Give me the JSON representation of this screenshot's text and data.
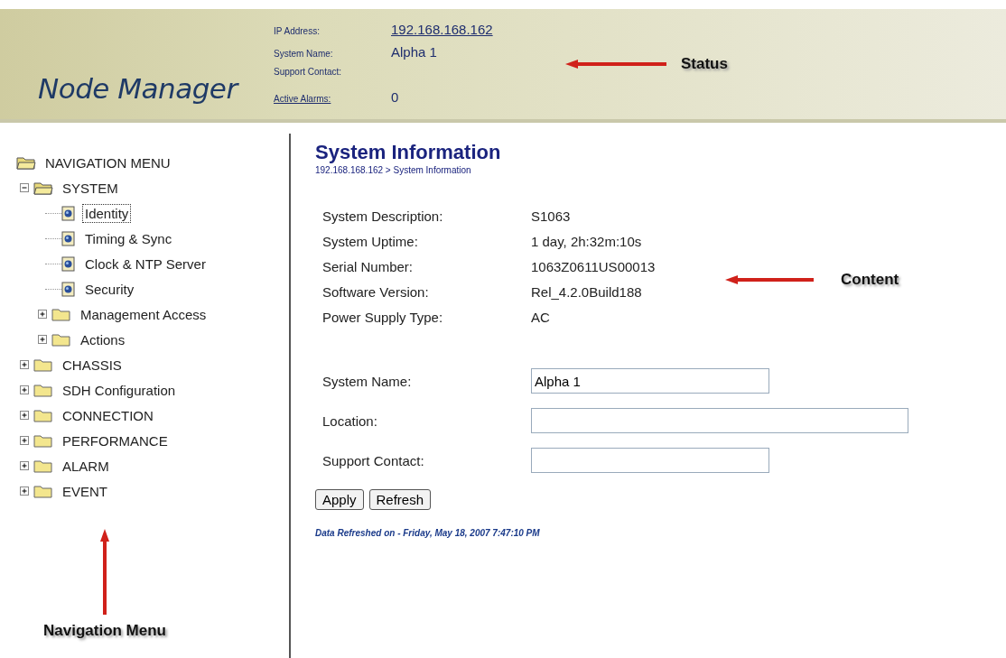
{
  "header": {
    "title": "Node Manager",
    "status": [
      {
        "label": "IP Address:",
        "value": "192.168.168.162",
        "label_link": false,
        "value_link": true
      },
      {
        "label": "System Name:",
        "value": "Alpha 1",
        "label_link": false,
        "value_link": false
      },
      {
        "label": "Support Contact:",
        "label_link": false
      },
      {
        "label": "Active Alarms:",
        "value": "0",
        "label_link": true,
        "value_link": false
      }
    ]
  },
  "navigation": {
    "title": "NAVIGATION MENU",
    "items": [
      {
        "label": "SYSTEM",
        "kind": "folder",
        "expanded": true,
        "children": [
          {
            "label": "Identity",
            "kind": "page",
            "selected": true
          },
          {
            "label": "Timing & Sync",
            "kind": "page",
            "selected": false
          },
          {
            "label": "Clock & NTP Server",
            "kind": "page",
            "selected": false
          },
          {
            "label": "Security",
            "kind": "page",
            "selected": false
          },
          {
            "label": "Management Access",
            "kind": "folder",
            "expanded": false
          },
          {
            "label": "Actions",
            "kind": "folder",
            "expanded": false
          }
        ]
      },
      {
        "label": "CHASSIS",
        "kind": "folder",
        "expanded": false
      },
      {
        "label": "SDH Configuration",
        "kind": "folder",
        "expanded": false
      },
      {
        "label": "CONNECTION",
        "kind": "folder",
        "expanded": false
      },
      {
        "label": "PERFORMANCE",
        "kind": "folder",
        "expanded": false
      },
      {
        "label": "ALARM",
        "kind": "folder",
        "expanded": false
      },
      {
        "label": "EVENT",
        "kind": "folder",
        "expanded": false
      }
    ]
  },
  "content": {
    "title": "System Information",
    "breadcrumb": "192.168.168.162 > System Information",
    "info": [
      {
        "label": "System Description:",
        "value": "S1063"
      },
      {
        "label": "System Uptime:",
        "value": "1 day, 2h:32m:10s"
      },
      {
        "label": "Serial Number:",
        "value": "1063Z0611US00013"
      },
      {
        "label": "Software Version:",
        "value": "Rel_4.2.0Build188"
      },
      {
        "label": "Power Supply Type:",
        "value": "AC"
      }
    ],
    "form": [
      {
        "label": "System Name:",
        "value": "Alpha 1"
      },
      {
        "label": "Location:"
      },
      {
        "label": "Support Contact:"
      }
    ],
    "buttons": [
      "Apply",
      "Refresh"
    ],
    "footer": "Data Refreshed on - Friday, May 18, 2007 7:47:10 PM"
  },
  "annotations": [
    "Status",
    "Content",
    "Navigation Menu"
  ]
}
